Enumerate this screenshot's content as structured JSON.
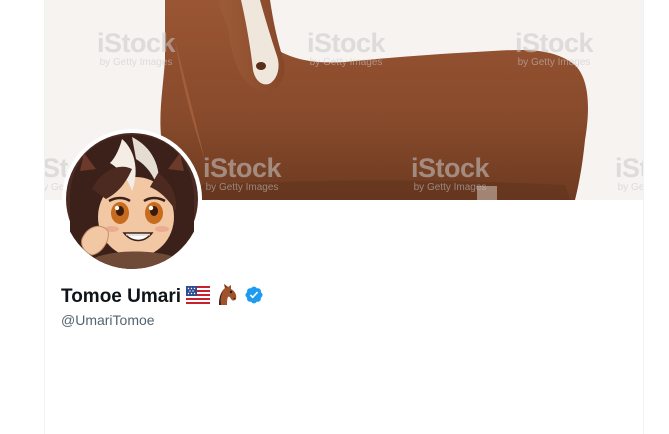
{
  "profile": {
    "display_name": "Tomoe Umari",
    "handle": "@UmariTomoe",
    "name_emojis": [
      "us-flag-icon",
      "horse-face-icon"
    ],
    "verified": true,
    "verified_color": "#1d9bf0"
  },
  "banner": {
    "watermark_main": "iStock",
    "watermark_sub": "by Getty Images",
    "subject_color": "#8a4a2a"
  }
}
